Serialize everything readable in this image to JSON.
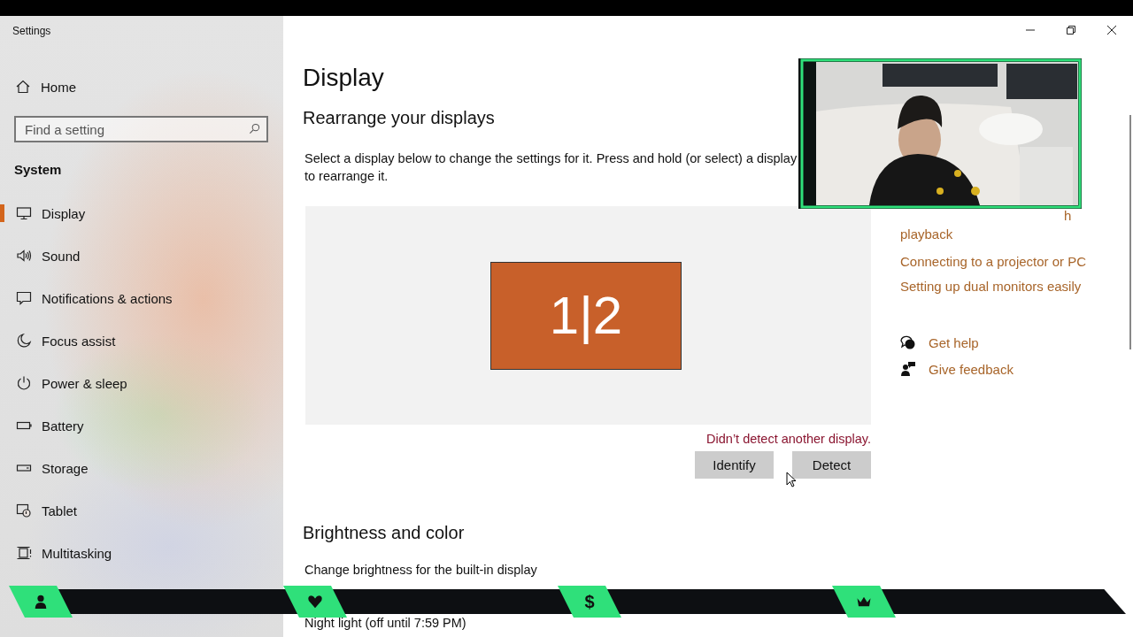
{
  "window": {
    "title": "Settings"
  },
  "sidebar": {
    "home": "Home",
    "search": {
      "placeholder": "Find a setting"
    },
    "section": "System",
    "items": [
      {
        "label": "Display",
        "selected": true
      },
      {
        "label": "Sound",
        "selected": false
      },
      {
        "label": "Notifications & actions",
        "selected": false
      },
      {
        "label": "Focus assist",
        "selected": false
      },
      {
        "label": "Power & sleep",
        "selected": false
      },
      {
        "label": "Battery",
        "selected": false
      },
      {
        "label": "Storage",
        "selected": false
      },
      {
        "label": "Tablet",
        "selected": false
      },
      {
        "label": "Multitasking",
        "selected": false
      }
    ]
  },
  "main": {
    "title": "Display",
    "arrange_heading": "Rearrange your displays",
    "description": [
      "Select a display below to change the settings for it. Press and hold (or select) a display",
      "to rearrange it."
    ],
    "monitor_label": "1|2",
    "error": "Didn’t detect another display.",
    "buttons": [
      "Identify",
      "Detect"
    ],
    "brightness_heading": "Brightness and color",
    "brightness_label": "Change brightness for the built-in display",
    "night_light": "Night light (off until 7:59 PM)"
  },
  "related": {
    "fragments": [
      "h",
      "playback"
    ],
    "links": [
      "Connecting to a projector or PC",
      "Setting up dual monitors easily"
    ],
    "support": [
      "Get help",
      "Give feedback"
    ]
  },
  "stream_bar": {
    "badges": [
      {
        "kind": "person"
      },
      {
        "kind": "heart"
      },
      {
        "kind": "text",
        "text": "$"
      },
      {
        "kind": "crown"
      }
    ]
  }
}
